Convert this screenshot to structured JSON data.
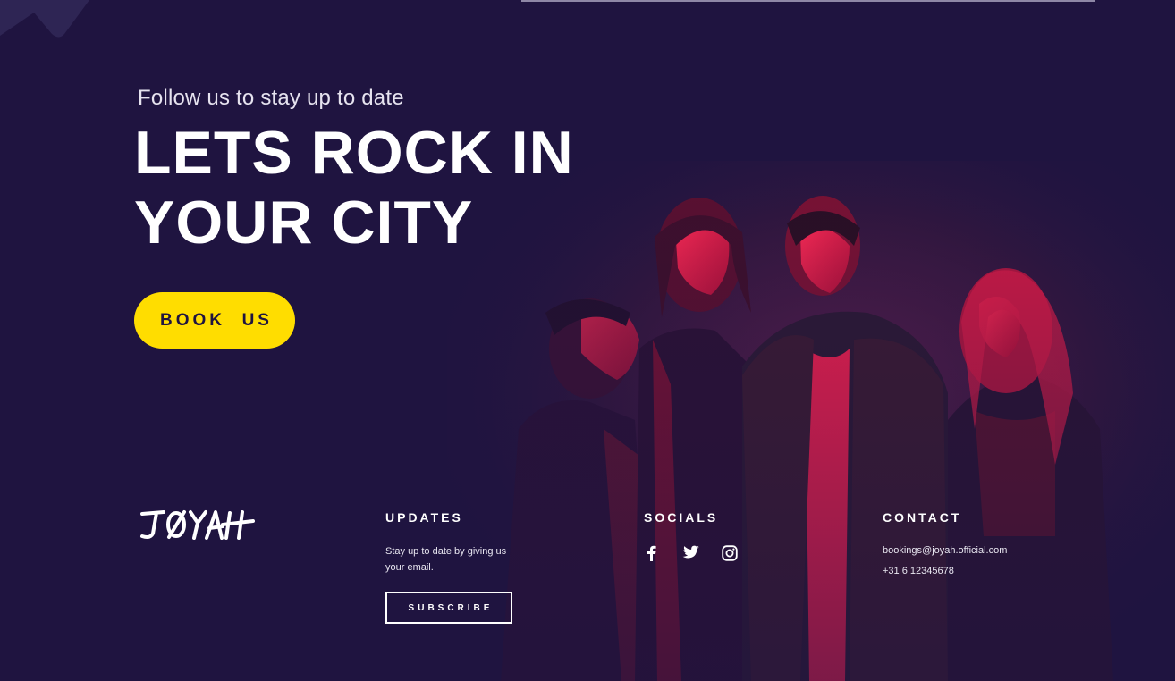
{
  "hero": {
    "subtitle": "Follow us to stay up to date",
    "title_line1": "LETS ROCK IN",
    "title_line2": "YOUR CITY",
    "cta_label": "BOOK  US"
  },
  "brand": {
    "logo_text": "JØYAH"
  },
  "footer": {
    "updates": {
      "title": "UPDATES",
      "text": "Stay up to date by giving us your email.",
      "subscribe_label": "SUBSCRIBE"
    },
    "socials": {
      "title": "SOCIALS",
      "icons": [
        "facebook-icon",
        "twitter-icon",
        "instagram-icon"
      ]
    },
    "contact": {
      "title": "CONTACT",
      "email": "bookings@joyah.official.com",
      "phone": "+31 6 12345678"
    }
  },
  "colors": {
    "background": "#1f1440",
    "accent": "#ffdd00",
    "photo_tint": "#e0143c",
    "text": "#ffffff"
  }
}
